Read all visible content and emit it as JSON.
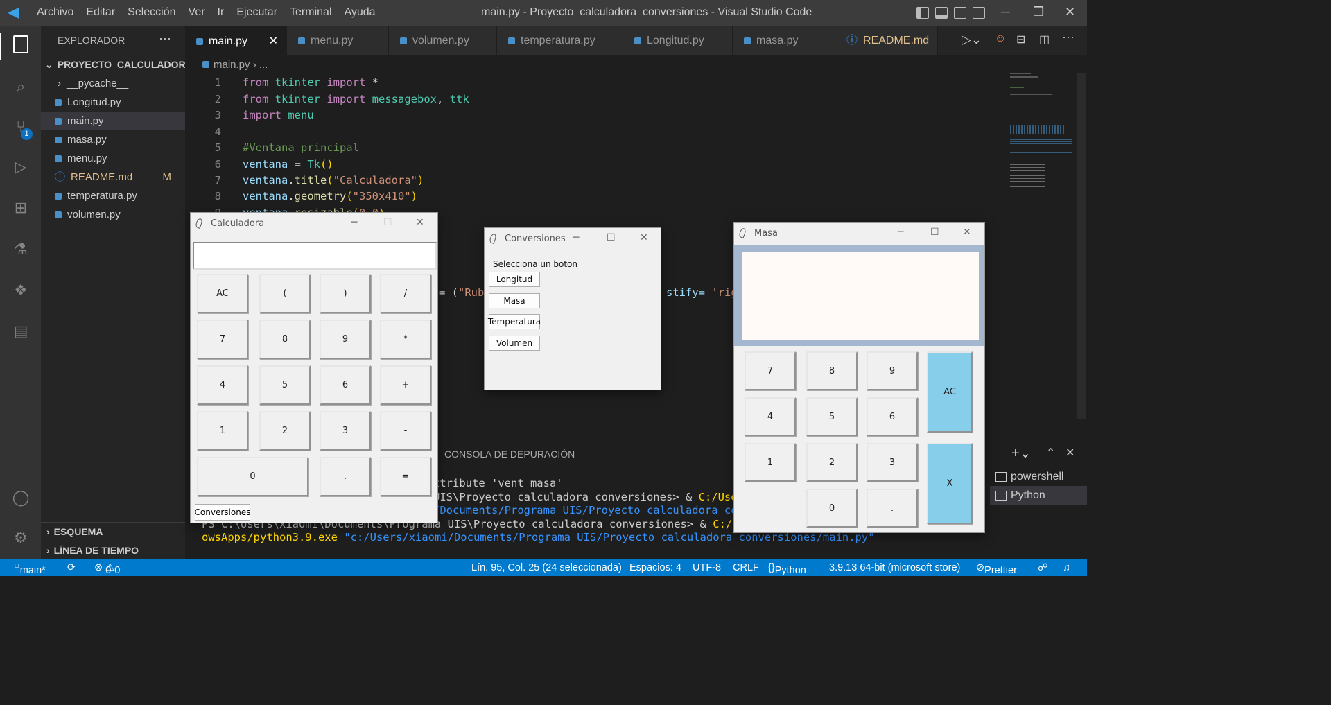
{
  "titlebar": {
    "menu": [
      "Archivo",
      "Editar",
      "Selección",
      "Ver",
      "Ir",
      "Ejecutar",
      "Terminal",
      "Ayuda"
    ],
    "title": "main.py - Proyecto_calculadora_conversiones - Visual Studio Code"
  },
  "activity": {
    "scm_badge": "1"
  },
  "sidebar": {
    "header": "EXPLORADOR",
    "project": "PROYECTO_CALCULADOR...",
    "folder": "__pycache__",
    "files": [
      "Longitud.py",
      "main.py",
      "masa.py",
      "menu.py",
      "README.md",
      "temperatura.py",
      "volumen.py"
    ],
    "readme_badge": "M",
    "outline": "ESQUEMA",
    "timeline": "LÍNEA DE TIEMPO"
  },
  "tabs": [
    "main.py",
    "menu.py",
    "volumen.py",
    "temperatura.py",
    "Longitud.py",
    "masa.py",
    "README.md"
  ],
  "readme_tab_badge": "M",
  "breadcrumb": {
    "file": "main.py",
    "rest": "..."
  },
  "code": {
    "line_numbers": [
      "1",
      "2",
      "3",
      "4",
      "5",
      "6",
      "7",
      "8",
      "9"
    ],
    "l1": [
      "from",
      " tkinter ",
      "import",
      " *"
    ],
    "l2": [
      "from",
      " tkinter ",
      "import",
      " messagebox",
      ", ",
      "ttk"
    ],
    "l3": [
      "import",
      " menu"
    ],
    "l5": "#Ventana principal",
    "l6": [
      "ventana",
      " = ",
      "Tk",
      "()"
    ],
    "l7": [
      "ventana",
      ".",
      "title",
      "(",
      "\"Calculadora\"",
      ")"
    ],
    "l8": [
      "ventana",
      ".",
      "geometry",
      "(",
      "\"350x410\"",
      ")"
    ],
    "l9": [
      "ventana",
      ".",
      "resizable",
      "(",
      "0",
      ",",
      "0",
      ")"
    ],
    "frag1": [
      "= (",
      "\"Rub"
    ],
    "frag2": [
      "stify= ",
      "'rig"
    ]
  },
  "panel": {
    "tab": "CONSOLA DE DEPURACIÓN",
    "lines": [
      "ttribute 'vent_masa'",
      "UIS\\Proyecto_calculadora_conversiones> & ",
      "/Documents/Programa UIS/Proyecto_calculadora_con",
      "PS C:\\Users\\xiaomi\\Documents\\Programa UIS\\Proyecto_calculadora_conversiones> & ",
      "owsApps/python3.9.exe "
    ],
    "cuser": "C:/User",
    "cuse": "C:/Use",
    "path": "\"c:/Users/xiaomi/Documents/Programa UIS/Proyecto_calculadora_conversiones/main.py\"",
    "terminals": [
      "powershell",
      "Python"
    ]
  },
  "status": {
    "branch": "main*",
    "errors": "0",
    "warnings": "0",
    "position": "Lín. 95, Col. 25 (24 seleccionada)",
    "spaces": "Espacios: 4",
    "encoding": "UTF-8",
    "eol": "CRLF",
    "language": "Python",
    "interpreter": "3.9.13 64-bit (microsoft store)",
    "prettier": "Prettier"
  },
  "calculadora": {
    "title": "Calculadora",
    "buttons": [
      "AC",
      "(",
      ")",
      "/",
      "7",
      "8",
      "9",
      "*",
      "4",
      "5",
      "6",
      "+",
      "1",
      "2",
      "3",
      "-",
      "0",
      ".",
      "="
    ],
    "conversiones_label": "Conversiones"
  },
  "conversiones": {
    "title": "Conversiones",
    "prompt": "Selecciona un boton",
    "buttons": [
      "Longitud",
      "Masa",
      "Temperatura",
      "Volumen"
    ]
  },
  "masa": {
    "title": "Masa",
    "buttons": [
      "7",
      "8",
      "9",
      "4",
      "5",
      "6",
      "1",
      "2",
      "3",
      "0",
      "."
    ],
    "ac": "AC",
    "x": "X",
    "accent": "#87ceeb"
  }
}
